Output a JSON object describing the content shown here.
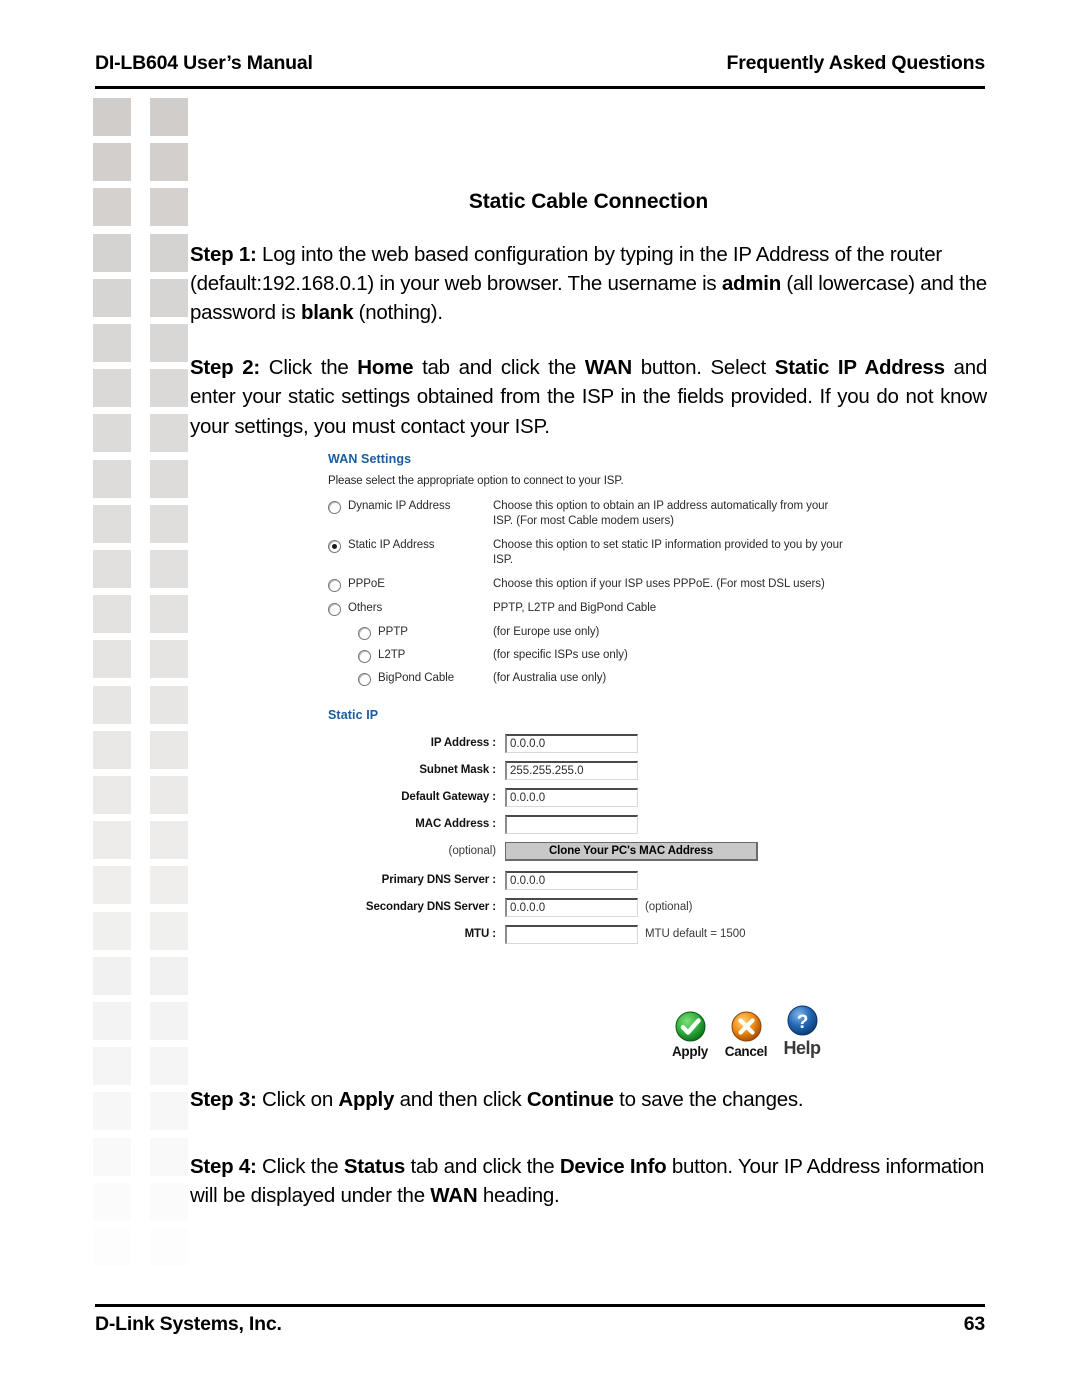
{
  "header": {
    "left": "DI-LB604 User’s Manual",
    "right": "Frequently Asked Questions"
  },
  "footer": {
    "left": "D-Link Systems, Inc.",
    "page_number": "63"
  },
  "document": {
    "title": "Static Cable Connection",
    "steps": [
      {
        "label": "Step 1:",
        "text": " Log into the web based configuration by typing in the IP Address of the router (default:192.168.0.1) in your web browser. The username is admin (all lowercase) and the password is blank (nothing)."
      },
      {
        "label": "Step 2:",
        "text": " Click the Home tab and click the WAN button. Select Static IP Address and enter your static settings obtained from the ISP in the fields provided. If you do not know your settings, you must contact your ISP."
      },
      {
        "label": "Step 3:",
        "text": " Click on Apply and then click Continue to save the changes."
      },
      {
        "label": "Step 4:",
        "text": " Click the Status tab and click the Device Info button. Your IP Address information will be displayed under the WAN heading."
      }
    ],
    "step1": {
      "label": "Step 1:",
      "t1": " Log into the web based configuration by typing in the IP Address of the router (default:192.168.0.1) in your web browser. The username is ",
      "b1": "admin",
      "t2": " (all lowercase) and the password is ",
      "b2": "blank",
      "t3": " (nothing)."
    },
    "step2": {
      "label": "Step 2:",
      "t1": " Click the ",
      "b1": "Home",
      "t2": " tab and click the ",
      "b2": "WAN",
      "t3": " button. Select ",
      "b3": "Static IP Address",
      "t4": " and enter your static settings obtained from the ISP in the fields provided. If you do not know your settings, you must contact your ISP."
    },
    "step3": {
      "label": "Step 3:",
      "t1": " Click on ",
      "b1": "Apply",
      "t2": " and then click ",
      "b2": "Continue",
      "t3": " to save the changes."
    },
    "step4": {
      "label": "Step 4:",
      "t1": " Click the ",
      "b1": "Status",
      "t2": " tab and click the ",
      "b2": "Device Info",
      "t3": " button. Your IP Address information will be displayed under the ",
      "b3": "WAN",
      "t4": " heading."
    }
  },
  "router_ui": {
    "wan_settings_heading": "WAN Settings",
    "wan_settings_subtitle": "Please select the appropriate option to connect to your ISP.",
    "connection_options": [
      {
        "label": "Dynamic IP Address",
        "selected": false,
        "sub": false,
        "description": "Choose this option to obtain an IP address automatically from your ISP. (For most Cable modem users)"
      },
      {
        "label": "Static IP Address",
        "selected": true,
        "sub": false,
        "description": "Choose this option to set static IP information provided to you by your ISP."
      },
      {
        "label": "PPPoE",
        "selected": false,
        "sub": false,
        "description": "Choose this option if your ISP uses PPPoE. (For most DSL users)"
      },
      {
        "label": "Others",
        "selected": false,
        "sub": false,
        "description": "PPTP, L2TP and BigPond Cable"
      },
      {
        "label": "PPTP",
        "selected": false,
        "sub": true,
        "description": "(for Europe use only)"
      },
      {
        "label": "L2TP",
        "selected": false,
        "sub": true,
        "description": "(for specific ISPs use only)"
      },
      {
        "label": "BigPond Cable",
        "selected": false,
        "sub": true,
        "description": "(for Australia use only)"
      }
    ],
    "static_ip_heading": "Static IP",
    "fields": [
      {
        "label": "IP Address :",
        "value": "0.0.0.0",
        "aux": ""
      },
      {
        "label": "Subnet Mask :",
        "value": "255.255.255.0",
        "aux": ""
      },
      {
        "label": "Default Gateway :",
        "value": "0.0.0.0",
        "aux": ""
      },
      {
        "label": "MAC Address :",
        "value": "",
        "aux": ""
      }
    ],
    "clone_row": {
      "optional_label": "(optional)",
      "button_label": "Clone Your PC's MAC Address"
    },
    "dns_fields": [
      {
        "label": "Primary DNS Server :",
        "value": "0.0.0.0",
        "aux": ""
      },
      {
        "label": "Secondary DNS Server :",
        "value": "0.0.0.0",
        "aux": "(optional)"
      },
      {
        "label": "MTU :",
        "value": "",
        "aux": "MTU default = 1500"
      }
    ],
    "actions": [
      {
        "name": "apply",
        "label": "Apply",
        "icon": "check-circle-icon",
        "color": "#1f9e2e"
      },
      {
        "name": "cancel",
        "label": "Cancel",
        "icon": "x-circle-icon",
        "color": "#e07a16"
      },
      {
        "name": "help",
        "label": "Help",
        "icon": "question-circle-icon",
        "color": "#1d5fa8"
      }
    ]
  },
  "decoration": {
    "square_color": "#d4d2d0",
    "columns": 2,
    "rows": 26
  }
}
